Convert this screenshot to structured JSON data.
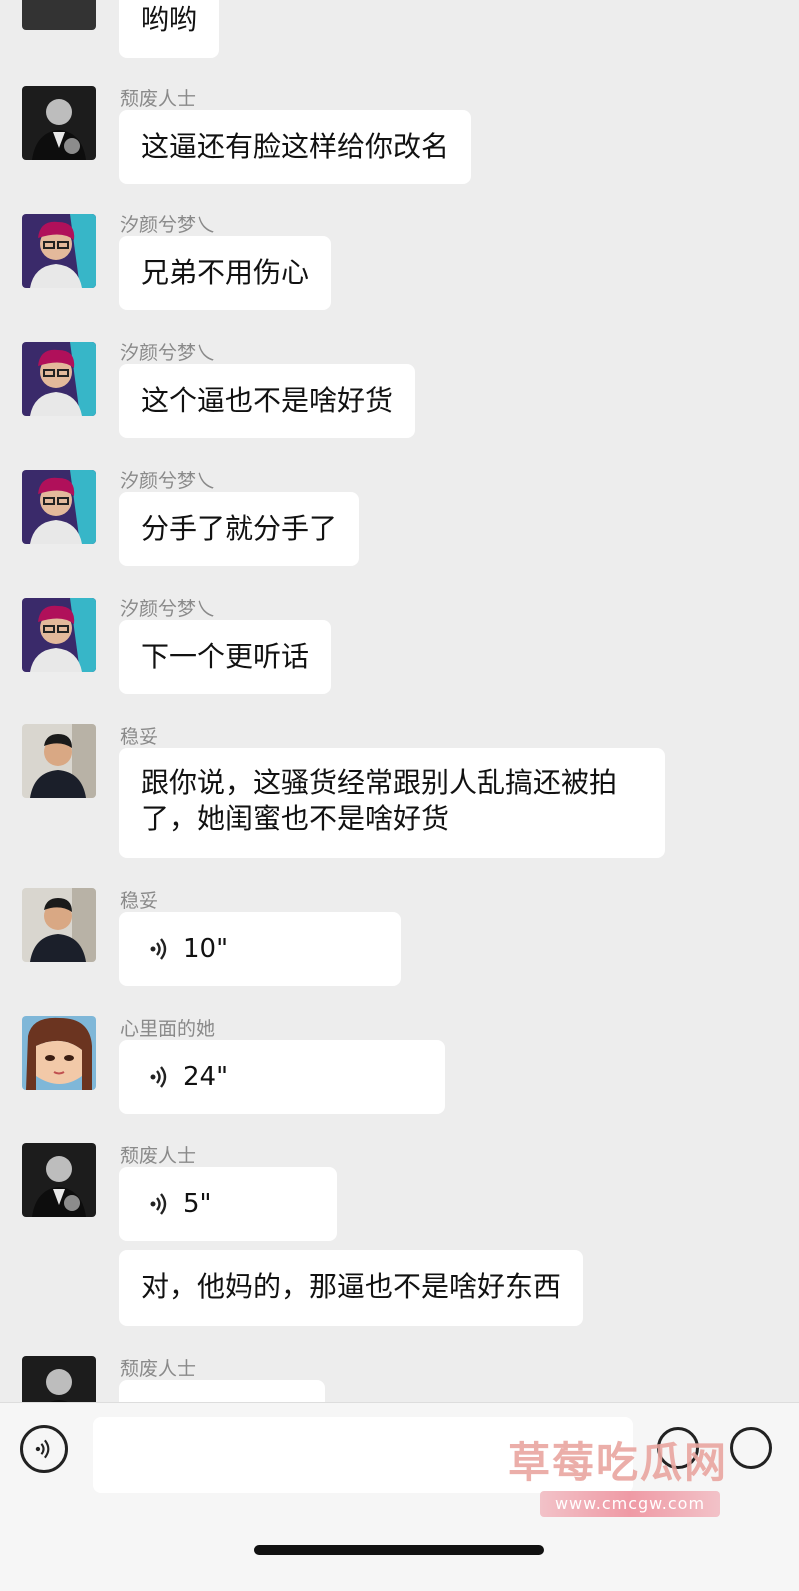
{
  "chat": {
    "top_partial_message": "哟哟",
    "messages": [
      {
        "sender": "颓废人士",
        "type": "text",
        "text": "这逼还有脸这样给你改名",
        "avatar": "man-in-suit-avatar"
      },
      {
        "sender": "汐颜兮梦乀",
        "type": "text",
        "text": "兄弟不用伤心",
        "avatar": "glasses-boy-avatar"
      },
      {
        "sender": "汐颜兮梦乀",
        "type": "text",
        "text": "这个逼也不是啥好货",
        "avatar": "glasses-boy-avatar"
      },
      {
        "sender": "汐颜兮梦乀",
        "type": "text",
        "text": "分手了就分手了",
        "avatar": "glasses-boy-avatar"
      },
      {
        "sender": "汐颜兮梦乀",
        "type": "text",
        "text": "下一个更听话",
        "avatar": "glasses-boy-avatar"
      },
      {
        "sender": "稳妥",
        "type": "text",
        "text": "跟你说，这骚货经常跟别人乱搞还被拍了，她闺蜜也不是啥好货",
        "avatar": "young-man-avatar"
      },
      {
        "sender": "稳妥",
        "type": "voice",
        "duration": "10\"",
        "avatar": "young-man-avatar"
      },
      {
        "sender": "心里面的她",
        "type": "voice",
        "duration": "24\"",
        "avatar": "anime-girl-avatar"
      },
      {
        "sender": "颓废人士",
        "type": "voice",
        "duration": "5\"",
        "avatar": "man-in-suit-avatar"
      },
      {
        "sender": "",
        "type": "text",
        "text": "对，他妈的，那逼也不是啥好东西"
      },
      {
        "sender": "颓废人士",
        "type": "partial",
        "avatar": "man-in-suit-avatar"
      }
    ]
  },
  "input_bar": {
    "voice_icon": "voice-toggle-icon",
    "emoji_icon": "emoji-icon",
    "plus_icon": "plus-icon"
  },
  "watermark": {
    "title": "草莓吃瓜网",
    "url": "www.cmcgw.com"
  },
  "colors": {
    "background": "#ededed",
    "bubble": "#ffffff",
    "sender_name": "#8a8a8a",
    "watermark": "#e9a6a0"
  }
}
